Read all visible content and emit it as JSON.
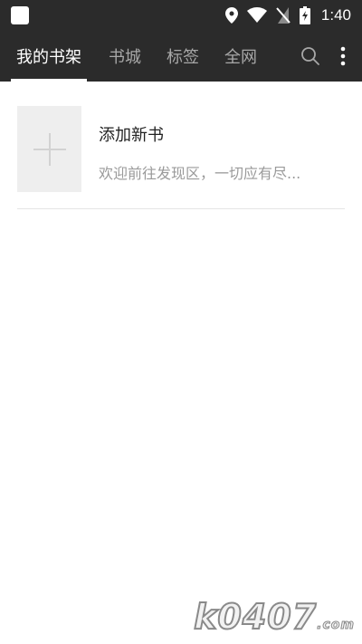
{
  "status_bar": {
    "time": "1:40",
    "icons": [
      "app-square-icon",
      "location-pin-icon",
      "wifi-icon",
      "no-sim-icon",
      "battery-charging-icon"
    ]
  },
  "toolbar": {
    "tabs": [
      {
        "label": "我的书架",
        "active": true
      },
      {
        "label": "书城",
        "active": false
      },
      {
        "label": "标签",
        "active": false
      },
      {
        "label": "全网",
        "active": false
      }
    ],
    "icons": [
      "search-icon",
      "more-vertical-icon"
    ]
  },
  "shelf": {
    "add_book": {
      "title": "添加新书",
      "description": "欢迎前往发现区，一切应有尽..."
    }
  },
  "watermark": {
    "text": "k0407",
    "suffix": ".com"
  },
  "colors": {
    "bar": "#2b2b2b",
    "tab_active": "#ffffff",
    "tab_inactive": "#a8a8a8",
    "cover": "#eeeeee"
  }
}
